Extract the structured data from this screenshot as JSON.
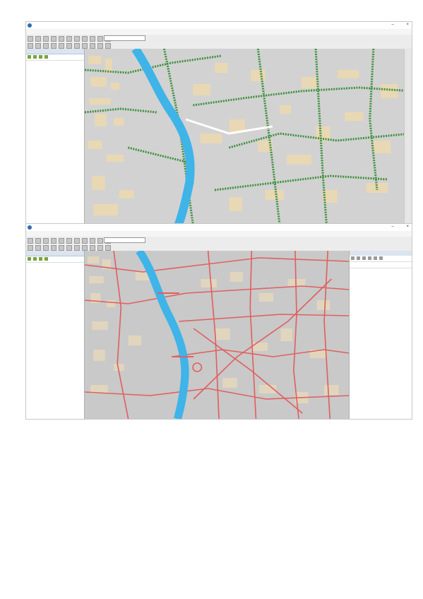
{
  "window1": {
    "title": "",
    "win_buttons": {
      "minimize": "–",
      "close": "×"
    },
    "menu": [],
    "scale": "",
    "toc": {
      "title": "",
      "items": []
    },
    "side_tabs": []
  },
  "window2": {
    "title": "",
    "win_buttons": {
      "minimize": "–",
      "close": "×"
    },
    "menu": [],
    "scale": "",
    "toc": {
      "title": "",
      "items": []
    },
    "catalog": {
      "title": "",
      "location": "",
      "items": []
    }
  },
  "page_side_tabs": [],
  "colors": {
    "river": "#3fb4e8",
    "streets": "#e06060",
    "buildings": "#e9d8b4",
    "vegetation": "#2f8a2f",
    "map_bg": "#cfcfcf",
    "selection": "#3399ff"
  },
  "icons": {
    "app": "arcmap-globe-icon",
    "folder": "folder-icon",
    "layer_checkbox": "checkbox-icon"
  }
}
